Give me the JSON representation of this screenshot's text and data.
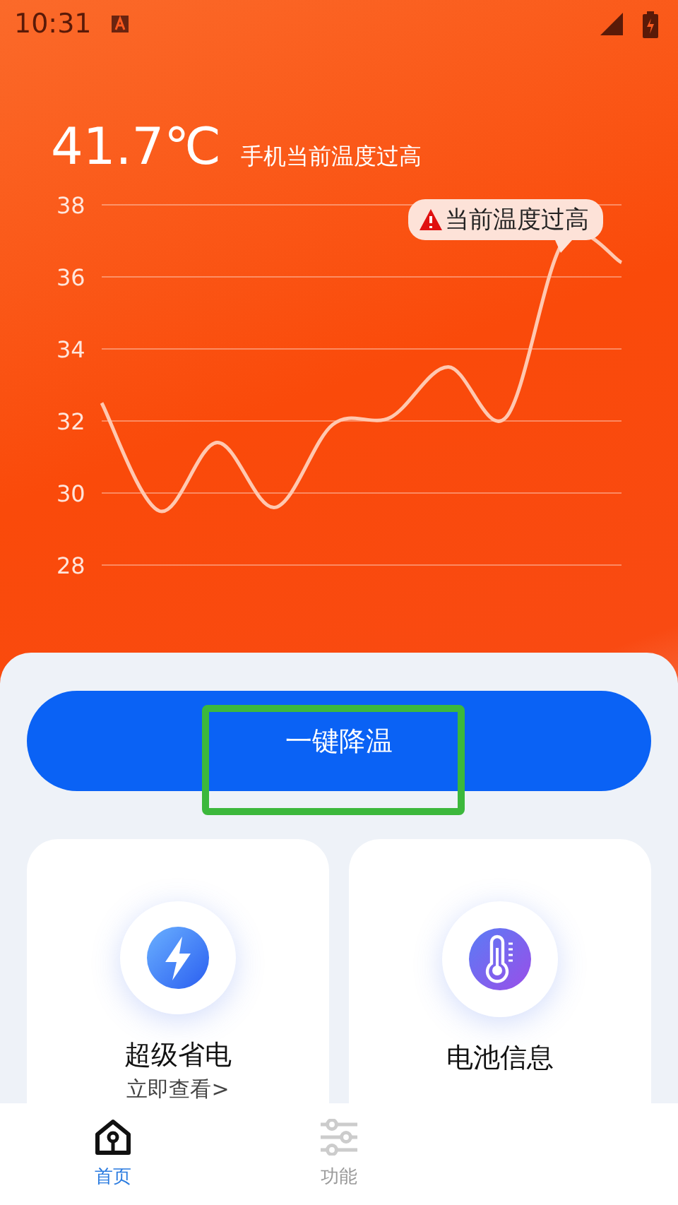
{
  "status_bar": {
    "time": "10:31"
  },
  "header": {
    "temperature": "41.7℃",
    "status": "手机当前温度过高"
  },
  "chart": {
    "tooltip": "当前温度过高",
    "chart_data": {
      "type": "line",
      "grid": true,
      "ylim": [
        28,
        38
      ],
      "yticks": [
        28,
        30,
        32,
        34,
        36,
        38
      ],
      "series": [
        {
          "color": "#ffc8b0",
          "values": [
            32.5,
            29.5,
            31.4,
            29.6,
            31.9,
            32.1,
            33.5,
            32.1,
            37,
            36.4
          ]
        }
      ]
    }
  },
  "cool_button": {
    "label": "一键降温"
  },
  "cards": [
    {
      "kind": "bolt",
      "title": "超级省电",
      "subtitle": "立即查看>"
    },
    {
      "kind": "thermometer",
      "title": "电池信息"
    }
  ],
  "nav": [
    {
      "label": "首页",
      "kind": "home",
      "selected": true
    },
    {
      "label": "功能",
      "kind": "sliders",
      "selected": false
    }
  ]
}
